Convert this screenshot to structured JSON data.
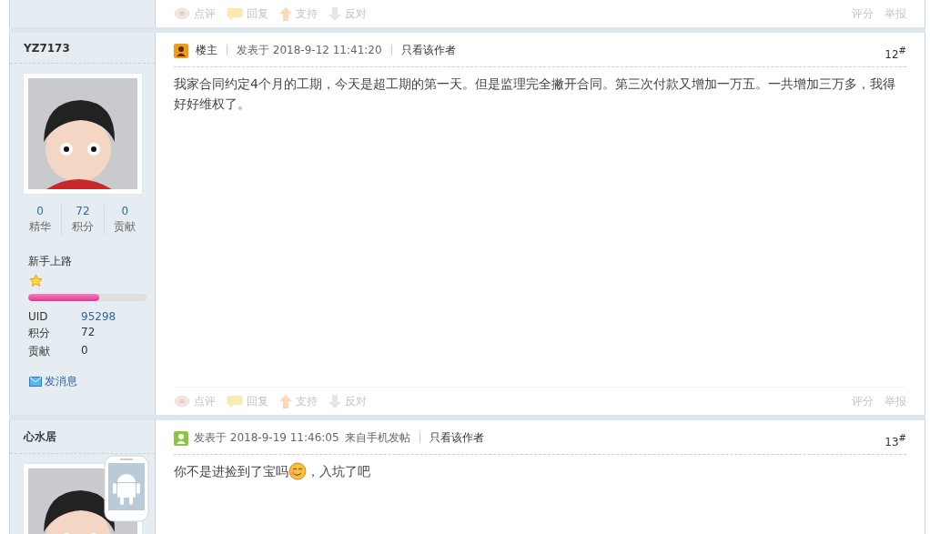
{
  "top_footer": {
    "actions": [
      "点评",
      "回复",
      "支持",
      "反对"
    ],
    "right_actions": [
      "评分",
      "举报"
    ]
  },
  "posts": [
    {
      "author": "YZ7173",
      "mobile": false,
      "stats": [
        {
          "value": "0",
          "label": "精华"
        },
        {
          "value": "72",
          "label": "积分"
        },
        {
          "value": "0",
          "label": "贡献"
        }
      ],
      "group": "新手上路",
      "level": 0.6,
      "profile": [
        {
          "label": "UID",
          "value": "95298",
          "link": true
        },
        {
          "label": "积分",
          "value": "72",
          "link": false
        },
        {
          "label": "贡献",
          "value": "0",
          "link": false
        }
      ],
      "message_link": "发消息",
      "op_label": "楼主",
      "posted": "发表于 2018-9-12 11:41:20",
      "author_only": "只看该作者",
      "floor": "12$^{#}$",
      "body": "我家合同约定4个月的工期，今天是超工期的第一天。但是监理完全撇开合同。第三次付款又增加一万五。一共增加三万多，我得好好维权了。",
      "footer": {
        "actions": [
          "点评",
          "回复",
          "支持",
          "反对"
        ],
        "right_actions": [
          "评分",
          "举报"
        ]
      }
    },
    {
      "author": "心水居",
      "mobile": true,
      "posted": "发表于 2018-9-19 11:46:05",
      "source": "来自手机发帖",
      "author_only": "只看该作者",
      "floor": "13$^{#}$",
      "body": "你不是进捡到了宝吗",
      "body_after_emoji": "，入坑了吧"
    }
  ]
}
